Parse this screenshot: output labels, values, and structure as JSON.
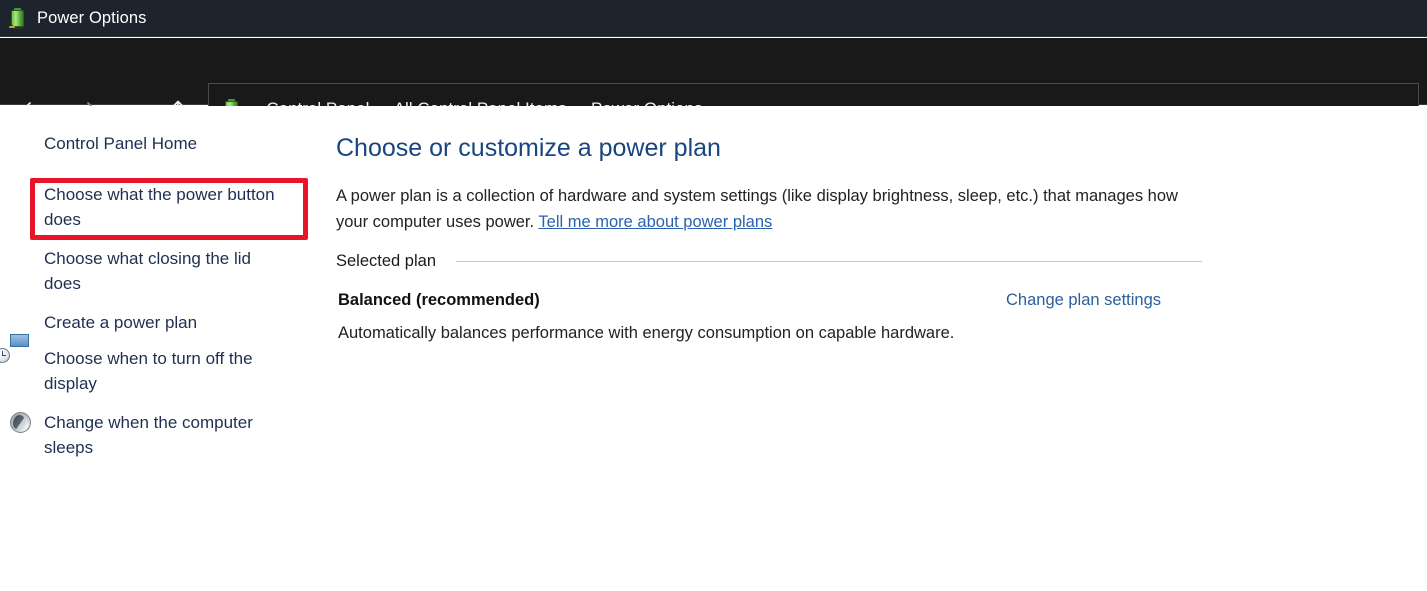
{
  "window": {
    "title": "Power Options",
    "icon": "battery-plug-icon"
  },
  "navbar": {
    "back_icon": "arrow-left-icon",
    "forward_icon": "arrow-right-icon",
    "recent_icon": "chevron-down-icon",
    "up_icon": "arrow-up-icon",
    "address_icon": "battery-plug-icon",
    "separator": "›",
    "breadcrumbs": [
      {
        "label": "Control Panel"
      },
      {
        "label": "All Control Panel Items"
      },
      {
        "label": "Power Options"
      }
    ]
  },
  "sidebar": {
    "items": [
      {
        "label": "Control Panel Home",
        "icon": null
      },
      {
        "label": "Choose what the power button does",
        "icon": null,
        "highlighted": true
      },
      {
        "label": "Choose what closing the lid does",
        "icon": null
      },
      {
        "label": "Create a power plan",
        "icon": null
      },
      {
        "label": "Choose when to turn off the display",
        "icon": "clock-monitor-icon"
      },
      {
        "label": "Change when the computer sleeps",
        "icon": "sleep-moon-icon"
      }
    ]
  },
  "main": {
    "heading": "Choose or customize a power plan",
    "description_text": "A power plan is a collection of hardware and system settings (like display brightness, sleep, etc.) that manages how your computer uses power. ",
    "description_link": "Tell me more about power plans",
    "selected_plan_label": "Selected plan",
    "plan_name": "Balanced (recommended)",
    "plan_description": "Automatically balances performance with energy consumption on capable hardware.",
    "change_plan_settings": "Change plan settings"
  },
  "colors": {
    "titlebar_bg": "#1e242d",
    "navbar_bg": "#191919",
    "heading_blue": "#19457f",
    "link_blue": "#2b62ad",
    "change_link_blue": "#2b6099",
    "sidebar_text": "#1f2f52",
    "highlight_red": "#e8152a"
  }
}
